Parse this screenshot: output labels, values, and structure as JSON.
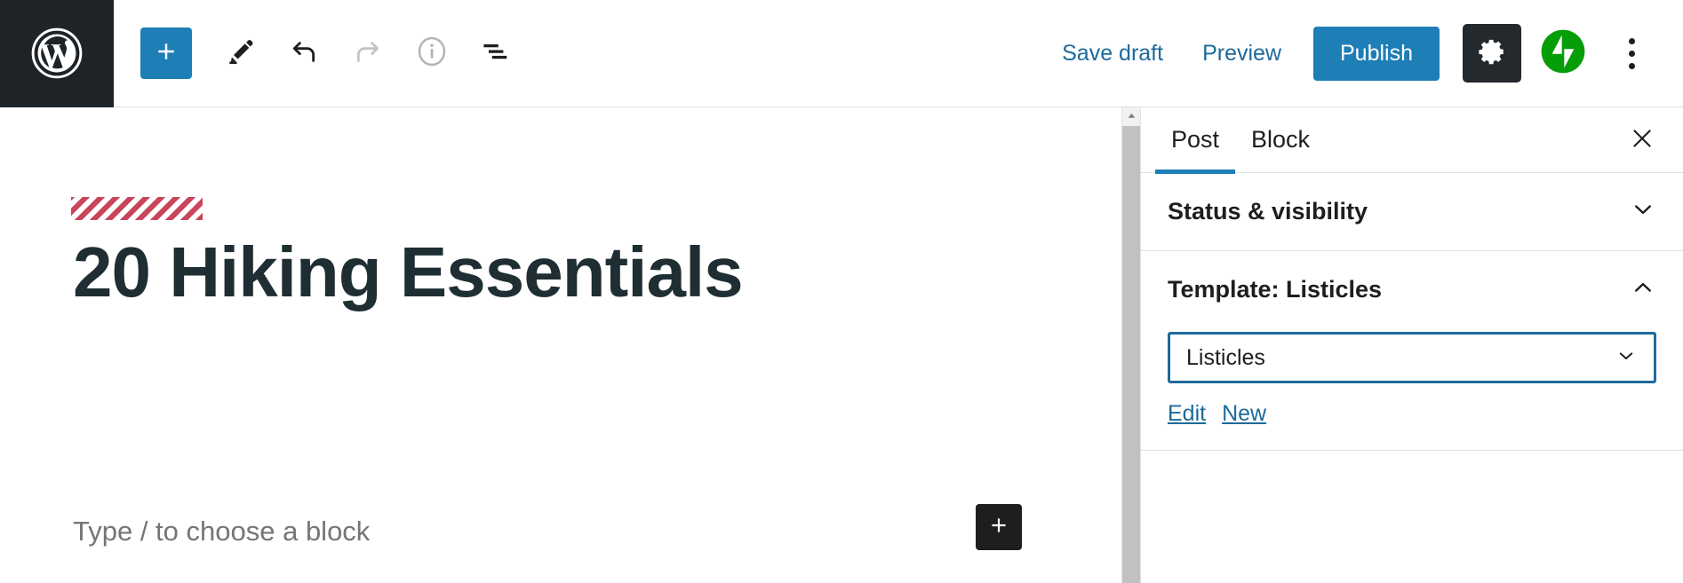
{
  "toolbar": {
    "wp_logo_label": "wordpress-logo",
    "add_block_label": "+",
    "tools": [
      {
        "name": "add-block-button",
        "label": "Add block"
      },
      {
        "name": "edit-mode-button",
        "label": "Tools"
      },
      {
        "name": "undo-button",
        "label": "Undo"
      },
      {
        "name": "redo-button",
        "label": "Redo"
      },
      {
        "name": "details-button",
        "label": "Details"
      },
      {
        "name": "list-view-button",
        "label": "List view"
      }
    ],
    "save_draft_label": "Save draft",
    "preview_label": "Preview",
    "publish_label": "Publish",
    "settings_label": "Settings",
    "jetpack_label": "Jetpack",
    "options_label": "Options"
  },
  "editor": {
    "post_title": "20 Hiking Essentials",
    "redacted_block_label": "redacted-content",
    "block_placeholder": "Type / to choose a block",
    "inline_add_label": "+"
  },
  "sidebar": {
    "tabs": [
      {
        "label": "Post",
        "active": true
      },
      {
        "label": "Block",
        "active": false
      }
    ],
    "close_label": "Close settings",
    "panels": [
      {
        "title": "Status & visibility",
        "expanded": false
      },
      {
        "title": "Template: Listicles",
        "expanded": true,
        "select_value": "Listicles",
        "select_options": [
          "Listicles"
        ],
        "links": [
          {
            "label": "Edit"
          },
          {
            "label": "New"
          }
        ]
      }
    ]
  },
  "colors": {
    "wp_bar_dark": "#1e2327",
    "accent_blue": "#1e7eb6",
    "link_blue": "#1e6a9a",
    "title_dark": "#1e2e33",
    "placeholder_gray": "#757575",
    "redact_red": "#c8455c",
    "jetpack_green": "#069e08",
    "border_gray": "#e0e0e0"
  }
}
